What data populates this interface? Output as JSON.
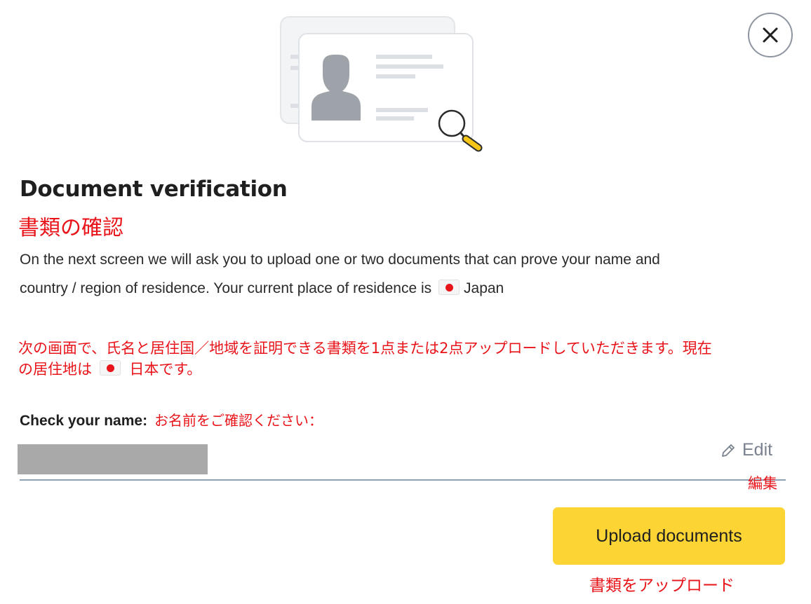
{
  "dialog": {
    "close_icon": "close-icon",
    "illustration_icon": "id-card-magnifier-icon",
    "title": "Document verification",
    "title_jp": "書類の確認",
    "description_text": "On the next screen we will ask you to upload one or two documents that can prove your name and country / region of residence. Your current place of residence is",
    "residence_flag_icon": "japan-flag-icon",
    "residence_country": "Japan",
    "description_jp_part1": "次の画面で、氏名と居住国／地域を証明できる書類を1点または2点アップロードしていただきます。現在の居住地は",
    "description_jp_country": "日本です。",
    "check_name_label": "Check your name:",
    "check_name_label_jp": "お名前をご確認ください：",
    "edit_icon": "pencil-icon",
    "edit_label": "Edit",
    "edit_label_jp": "編集",
    "upload_button_label": "Upload documents",
    "upload_button_label_jp": "書類をアップロード"
  },
  "colors": {
    "accent_yellow": "#fcd535",
    "translation_red": "#e8141a",
    "flag_red": "#e8141a",
    "underline": "#8fa3b8"
  }
}
